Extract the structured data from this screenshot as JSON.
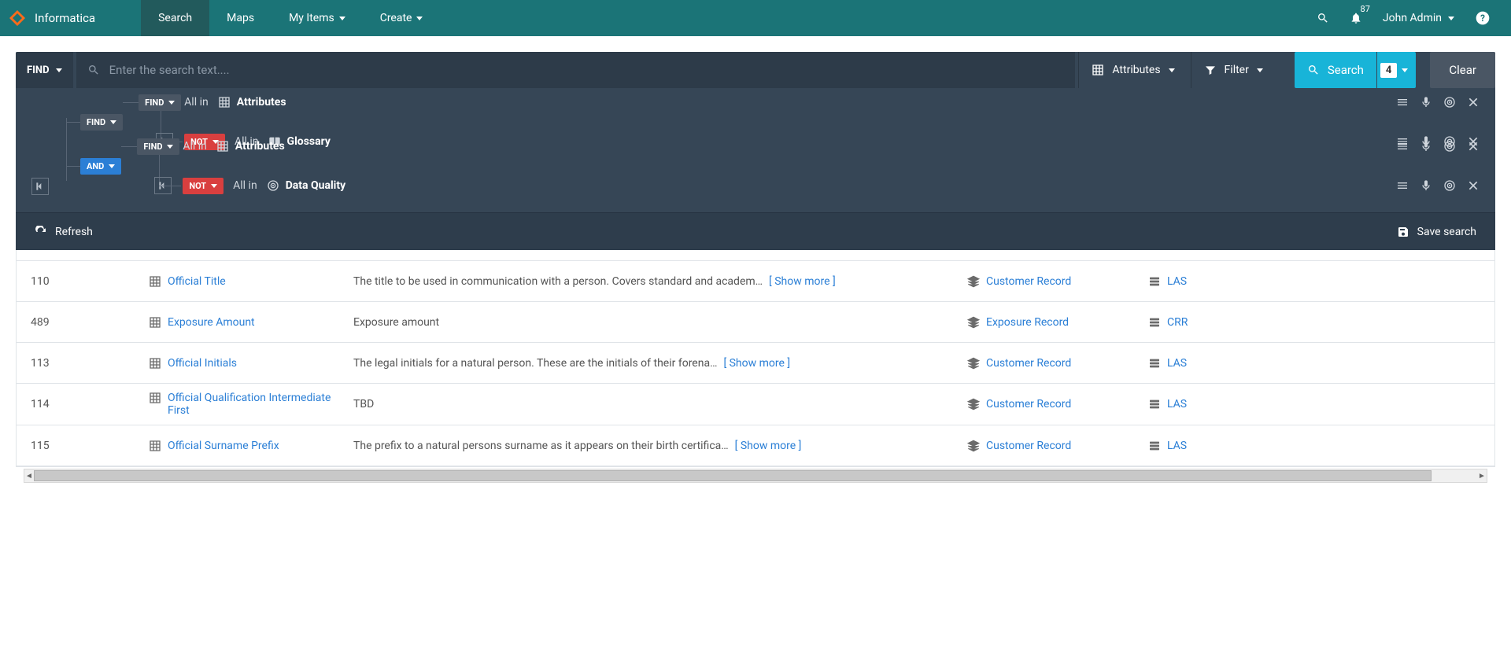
{
  "brand": "Informatica",
  "nav": {
    "search": "Search",
    "maps": "Maps",
    "myitems": "My Items",
    "create": "Create"
  },
  "notifications_count": "87",
  "user_name": "John Admin",
  "search": {
    "find": "FIND",
    "placeholder": "Enter the search text....",
    "attributes": "Attributes",
    "filter": "Filter",
    "search_btn": "Search",
    "count": "4",
    "clear": "Clear"
  },
  "query": {
    "allin": "All in",
    "scopes": {
      "attributes": "Attributes",
      "glossary": "Glossary",
      "dataquality": "Data Quality"
    },
    "ops": {
      "find": "FIND",
      "not": "NOT",
      "and": "AND"
    }
  },
  "toolbar": {
    "refresh": "Refresh",
    "save": "Save search"
  },
  "results": [
    {
      "id": "110",
      "name": "Official Title",
      "desc": "The title to be used in communication with a person. Covers standard and academ…",
      "show_more": "[ Show more ]",
      "record": "Customer Record",
      "system": "LAS"
    },
    {
      "id": "489",
      "name": "Exposure Amount",
      "desc": "Exposure amount",
      "show_more": "",
      "record": "Exposure Record",
      "system": "CRR"
    },
    {
      "id": "113",
      "name": "Official Initials",
      "desc": "The legal initials for a natural person. These are the initials of their forena…",
      "show_more": "[ Show more ]",
      "record": "Customer Record",
      "system": "LAS"
    },
    {
      "id": "114",
      "name": "Official Qualification Intermediate First",
      "desc": "TBD",
      "show_more": "",
      "record": "Customer Record",
      "system": "LAS"
    },
    {
      "id": "115",
      "name": "Official Surname Prefix",
      "desc": "The prefix to a natural persons surname as it appears on their birth certifica…",
      "show_more": "[ Show more ]",
      "record": "Customer Record",
      "system": "LAS"
    }
  ]
}
